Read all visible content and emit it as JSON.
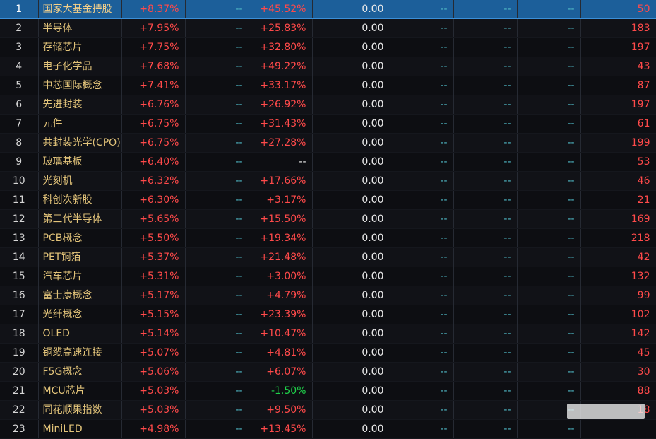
{
  "colors": {
    "up": "#ff4a4a",
    "down": "#1fd24a",
    "neutral": "#eaeaea",
    "dash": "#4fb8c5",
    "name": "#e3c47a",
    "selected_bg": "#1c5f9a"
  },
  "rows": [
    {
      "idx": "1",
      "name": "国家大基金持股",
      "chg": "+8.37%",
      "c3": "--",
      "c4": "+45.52%",
      "c5": "0.00",
      "c6": "--",
      "c7": "--",
      "c8": "--",
      "cnt": "50",
      "c4dir": "up"
    },
    {
      "idx": "2",
      "name": "半导体",
      "chg": "+7.95%",
      "c3": "--",
      "c4": "+25.83%",
      "c5": "0.00",
      "c6": "--",
      "c7": "--",
      "c8": "--",
      "cnt": "183",
      "c4dir": "up"
    },
    {
      "idx": "3",
      "name": "存储芯片",
      "chg": "+7.75%",
      "c3": "--",
      "c4": "+32.80%",
      "c5": "0.00",
      "c6": "--",
      "c7": "--",
      "c8": "--",
      "cnt": "197",
      "c4dir": "up"
    },
    {
      "idx": "4",
      "name": "电子化学品",
      "chg": "+7.68%",
      "c3": "--",
      "c4": "+49.22%",
      "c5": "0.00",
      "c6": "--",
      "c7": "--",
      "c8": "--",
      "cnt": "43",
      "c4dir": "up"
    },
    {
      "idx": "5",
      "name": "中芯国际概念",
      "chg": "+7.41%",
      "c3": "--",
      "c4": "+33.17%",
      "c5": "0.00",
      "c6": "--",
      "c7": "--",
      "c8": "--",
      "cnt": "87",
      "c4dir": "up"
    },
    {
      "idx": "6",
      "name": "先进封装",
      "chg": "+6.76%",
      "c3": "--",
      "c4": "+26.92%",
      "c5": "0.00",
      "c6": "--",
      "c7": "--",
      "c8": "--",
      "cnt": "197",
      "c4dir": "up"
    },
    {
      "idx": "7",
      "name": "元件",
      "chg": "+6.75%",
      "c3": "--",
      "c4": "+31.43%",
      "c5": "0.00",
      "c6": "--",
      "c7": "--",
      "c8": "--",
      "cnt": "61",
      "c4dir": "up"
    },
    {
      "idx": "8",
      "name": "共封装光学(CPO)",
      "chg": "+6.75%",
      "c3": "--",
      "c4": "+27.28%",
      "c5": "0.00",
      "c6": "--",
      "c7": "--",
      "c8": "--",
      "cnt": "199",
      "c4dir": "up"
    },
    {
      "idx": "9",
      "name": "玻璃基板",
      "chg": "+6.40%",
      "c3": "--",
      "c4": "--",
      "c5": "0.00",
      "c6": "--",
      "c7": "--",
      "c8": "--",
      "cnt": "53",
      "c4dir": "neutral"
    },
    {
      "idx": "10",
      "name": "光刻机",
      "chg": "+6.32%",
      "c3": "--",
      "c4": "+17.66%",
      "c5": "0.00",
      "c6": "--",
      "c7": "--",
      "c8": "--",
      "cnt": "46",
      "c4dir": "up"
    },
    {
      "idx": "11",
      "name": "科创次新股",
      "chg": "+6.30%",
      "c3": "--",
      "c4": "+3.17%",
      "c5": "0.00",
      "c6": "--",
      "c7": "--",
      "c8": "--",
      "cnt": "21",
      "c4dir": "up"
    },
    {
      "idx": "12",
      "name": "第三代半导体",
      "chg": "+5.65%",
      "c3": "--",
      "c4": "+15.50%",
      "c5": "0.00",
      "c6": "--",
      "c7": "--",
      "c8": "--",
      "cnt": "169",
      "c4dir": "up"
    },
    {
      "idx": "13",
      "name": "PCB概念",
      "chg": "+5.50%",
      "c3": "--",
      "c4": "+19.34%",
      "c5": "0.00",
      "c6": "--",
      "c7": "--",
      "c8": "--",
      "cnt": "218",
      "c4dir": "up"
    },
    {
      "idx": "14",
      "name": "PET铜箔",
      "chg": "+5.37%",
      "c3": "--",
      "c4": "+21.48%",
      "c5": "0.00",
      "c6": "--",
      "c7": "--",
      "c8": "--",
      "cnt": "42",
      "c4dir": "up"
    },
    {
      "idx": "15",
      "name": "汽车芯片",
      "chg": "+5.31%",
      "c3": "--",
      "c4": "+3.00%",
      "c5": "0.00",
      "c6": "--",
      "c7": "--",
      "c8": "--",
      "cnt": "132",
      "c4dir": "up"
    },
    {
      "idx": "16",
      "name": "富士康概念",
      "chg": "+5.17%",
      "c3": "--",
      "c4": "+4.79%",
      "c5": "0.00",
      "c6": "--",
      "c7": "--",
      "c8": "--",
      "cnt": "99",
      "c4dir": "up"
    },
    {
      "idx": "17",
      "name": "光纤概念",
      "chg": "+5.15%",
      "c3": "--",
      "c4": "+23.39%",
      "c5": "0.00",
      "c6": "--",
      "c7": "--",
      "c8": "--",
      "cnt": "102",
      "c4dir": "up"
    },
    {
      "idx": "18",
      "name": "OLED",
      "chg": "+5.14%",
      "c3": "--",
      "c4": "+10.47%",
      "c5": "0.00",
      "c6": "--",
      "c7": "--",
      "c8": "--",
      "cnt": "142",
      "c4dir": "up"
    },
    {
      "idx": "19",
      "name": "铜缆高速连接",
      "chg": "+5.07%",
      "c3": "--",
      "c4": "+4.81%",
      "c5": "0.00",
      "c6": "--",
      "c7": "--",
      "c8": "--",
      "cnt": "45",
      "c4dir": "up"
    },
    {
      "idx": "20",
      "name": "F5G概念",
      "chg": "+5.06%",
      "c3": "--",
      "c4": "+6.07%",
      "c5": "0.00",
      "c6": "--",
      "c7": "--",
      "c8": "--",
      "cnt": "30",
      "c4dir": "up"
    },
    {
      "idx": "21",
      "name": "MCU芯片",
      "chg": "+5.03%",
      "c3": "--",
      "c4": "-1.50%",
      "c5": "0.00",
      "c6": "--",
      "c7": "--",
      "c8": "--",
      "cnt": "88",
      "c4dir": "down"
    },
    {
      "idx": "22",
      "name": "同花顺果指数",
      "chg": "+5.03%",
      "c3": "--",
      "c4": "+9.50%",
      "c5": "0.00",
      "c6": "--",
      "c7": "--",
      "c8": "--",
      "cnt": "18",
      "c4dir": "up"
    },
    {
      "idx": "23",
      "name": "MiniLED",
      "chg": "+4.98%",
      "c3": "--",
      "c4": "+13.45%",
      "c5": "0.00",
      "c6": "--",
      "c7": "--",
      "c8": "--",
      "cnt": "",
      "c4dir": "up"
    }
  ]
}
